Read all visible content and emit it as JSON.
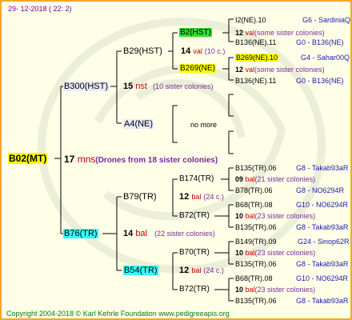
{
  "date": "29- 12-2018 ( 22: 2)",
  "root": {
    "name": "B02(MT)",
    "count": "17",
    "unit": "mns",
    "note": "(Drones from 18 sister colonies)"
  },
  "gen1": [
    {
      "name": "B300(HST)",
      "count": "15",
      "unit": "nst",
      "note": "(10 sister colonies)"
    },
    {
      "name": "B76(TR)",
      "count": "14",
      "unit": "bal",
      "note": "(22 sister colonies)"
    }
  ],
  "gen2": [
    {
      "name": "B29(HST)",
      "count": "14",
      "unit": "val",
      "note": "(10 c.)"
    },
    {
      "name": "A4(NE)",
      "note": "no more"
    },
    {
      "name": "B79(TR)",
      "count": "12",
      "unit": "bal",
      "note": "(24 c.)"
    },
    {
      "name": "B54(TR)",
      "count": "12",
      "unit": "bal",
      "note": "(24 c.)"
    }
  ],
  "gen3": [
    {
      "name": "B2(HST)",
      "count": "12",
      "unit": "val",
      "note": "(some sister colonies)"
    },
    {
      "name": "B269(NE)",
      "count": "12",
      "unit": "val",
      "note": "(some sister colonies)"
    },
    {
      "name": "B174(TR)",
      "count": "09",
      "unit": "bal",
      "note": "(21 sister colonies)"
    },
    {
      "name": "B72(TR)",
      "count": "10",
      "unit": "bal",
      "note": "(23 sister colonies)"
    },
    {
      "name": "B70(TR)",
      "count": "10",
      "unit": "bal",
      "note": "(23 sister colonies)"
    },
    {
      "name": "B72(TR)",
      "count": "10",
      "unit": "bal",
      "note": "(23 sister colonies)"
    }
  ],
  "gen4": [
    {
      "name": "I2(NE).10",
      "info": "G6 - SardiniaQ"
    },
    {
      "name": "B136(NE).11",
      "info": "G0 - B136(NE)"
    },
    {
      "name": "B269(NE).10",
      "info": "G4 - Sahar00Q"
    },
    {
      "name": "B136(NE).11",
      "info": "G0 - B136(NE)"
    },
    {
      "name": "B135(TR).06",
      "info": "G8 - Takab93aR"
    },
    {
      "name": "B78(TR).06",
      "info": "G8 - NO6294R"
    },
    {
      "name": "B68(TR).08",
      "info": "G10 - NO6294R"
    },
    {
      "name": "B135(TR).06",
      "info": "G8 - Takab93aR"
    },
    {
      "name": "B149(TR).09",
      "info": "G24 - Sinop62R"
    },
    {
      "name": "B135(TR).06",
      "info": "G8 - Takab93aR"
    },
    {
      "name": "B68(TR).08",
      "info": "G10 - NO6294R"
    },
    {
      "name": "B135(TR).06",
      "info": "G8 - Takab93aR"
    }
  ],
  "footer": "Copyright 2004-2018 © Karl Kehrle Foundation    www.pedigreeapis.org",
  "colors": {
    "border": "#f7a823",
    "background": "#ffffe8",
    "highlight_yellow": "#ffff00",
    "highlight_green": "#33dd33",
    "highlight_cyan": "#33ffff"
  }
}
